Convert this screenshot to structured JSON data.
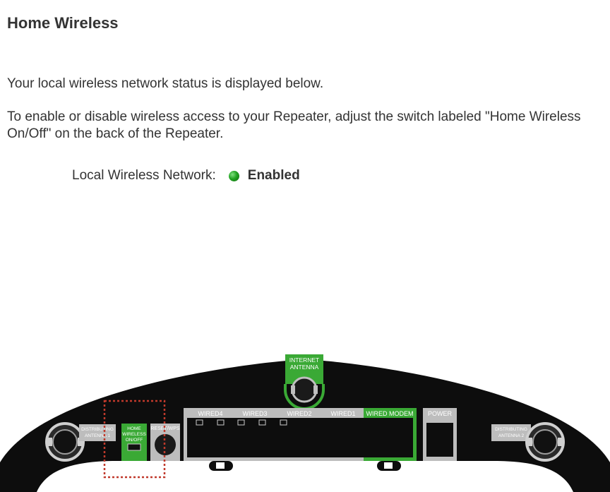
{
  "page": {
    "title": "Home Wireless",
    "intro": "Your local wireless network status is displayed below.",
    "instructions": "To enable or disable wireless access to your Repeater, adjust the switch labeled \"Home Wireless On/Off\" on the back of the Repeater."
  },
  "status": {
    "label": "Local Wireless Network:",
    "value": "Enabled",
    "indicator_color": "#22a322"
  },
  "device_diagram": {
    "internet_antenna": [
      "INTERNET",
      "ANTENNA"
    ],
    "distributing_antenna_1": [
      "DISTRIBUTING",
      "ANTENNA 1"
    ],
    "home_wireless_switch": [
      "HOME",
      "WIRELESS",
      "ON/OFF"
    ],
    "reset_wps": "RESET/WPS",
    "ports": [
      "WIRED4",
      "WIRED3",
      "WIRED2",
      "WIRED1"
    ],
    "wired_modem": "WIRED MODEM",
    "power": "POWER",
    "distributing_antenna_2": [
      "DISTRIBUTING",
      "ANTENNA 2"
    ],
    "highlight_color": "#3aa935",
    "callout_color": "#c0392b"
  }
}
